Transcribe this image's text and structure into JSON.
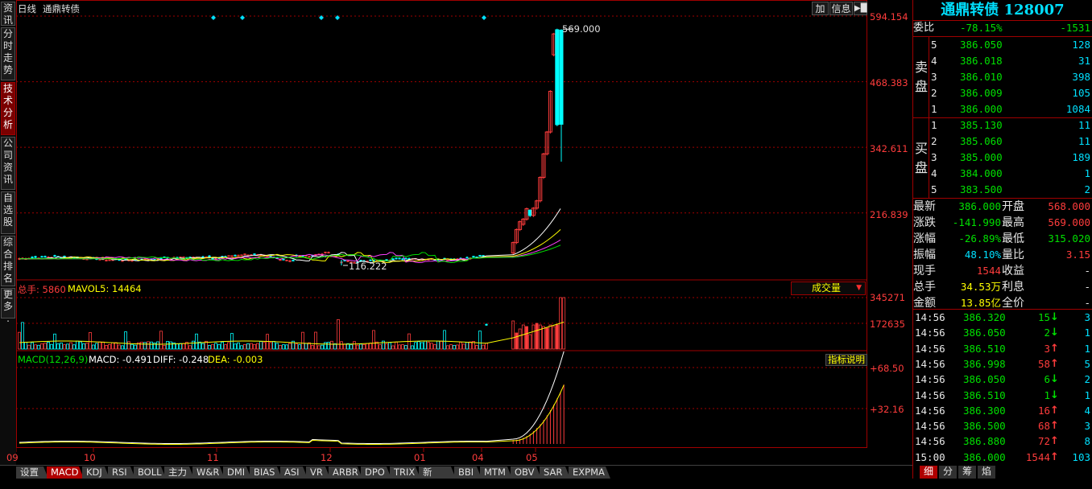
{
  "left_tabs": [
    {
      "label": "资讯",
      "active": false
    },
    {
      "label": "分时走势",
      "active": false
    },
    {
      "label": "技术分析",
      "active": true
    },
    {
      "label": "公司资讯",
      "active": false
    },
    {
      "label": "自选股",
      "active": false
    },
    {
      "label": "综合排名",
      "active": false
    },
    {
      "label": "更多.",
      "active": false
    }
  ],
  "chart_header": {
    "period": "日线",
    "name": "通鼎转债",
    "btn_add": "加",
    "btn_info": "信息"
  },
  "price_axis": [
    "594.154",
    "468.383",
    "342.611",
    "216.839"
  ],
  "price_annotations": {
    "high": "569.000",
    "low": "116.222"
  },
  "volume_pane": {
    "label_total": "总手:",
    "total_value": "5860",
    "label_mavol": "MAVOL5:",
    "mavol_value": "14464",
    "axis": [
      "345271",
      "172635"
    ],
    "selector": "成交量"
  },
  "macd_pane": {
    "label": "MACD(12,26,9)",
    "macd": "MACD: -0.491",
    "diff": "DIFF: -0.248",
    "dea": "DEA: -0.003",
    "axis": [
      "+68.50",
      "+32.16"
    ],
    "help": "指标说明"
  },
  "x_axis": [
    "09",
    "10",
    "11",
    "12",
    "01",
    "04",
    "05"
  ],
  "bottom_tabs": [
    "设置",
    "MACD",
    "KDJ",
    "RSI",
    "BOLL",
    "主力",
    "W&R",
    "DMI",
    "BIAS",
    "ASI",
    "VR",
    "ARBR",
    "DPO",
    "TRIX",
    "新DMA",
    "BBI",
    "MTM",
    "OBV",
    "SAR",
    "EXPMA"
  ],
  "bottom_active": "MACD",
  "quote": {
    "title": "通鼎转债 128007",
    "weibi": {
      "label": "委比",
      "pct": "-78.15%",
      "diff": "-1531"
    },
    "sell_label": "卖盘",
    "buy_label": "买盘",
    "asks": [
      {
        "lvl": "5",
        "price": "386.050",
        "vol": "128"
      },
      {
        "lvl": "4",
        "price": "386.018",
        "vol": "31"
      },
      {
        "lvl": "3",
        "price": "386.010",
        "vol": "398"
      },
      {
        "lvl": "2",
        "price": "386.009",
        "vol": "105"
      },
      {
        "lvl": "1",
        "price": "386.000",
        "vol": "1084"
      }
    ],
    "bids": [
      {
        "lvl": "1",
        "price": "385.130",
        "vol": "11"
      },
      {
        "lvl": "2",
        "price": "385.060",
        "vol": "11"
      },
      {
        "lvl": "3",
        "price": "385.000",
        "vol": "189"
      },
      {
        "lvl": "4",
        "price": "384.000",
        "vol": "1"
      },
      {
        "lvl": "5",
        "price": "383.500",
        "vol": "2"
      }
    ],
    "stats": [
      {
        "l1": "最新",
        "v1": "386.000",
        "c1": "green",
        "l2": "开盘",
        "v2": "568.000",
        "c2": "red"
      },
      {
        "l1": "涨跌",
        "v1": "-141.990",
        "c1": "green",
        "l2": "最高",
        "v2": "569.000",
        "c2": "red"
      },
      {
        "l1": "涨幅",
        "v1": "-26.89%",
        "c1": "green",
        "l2": "最低",
        "v2": "315.020",
        "c2": "green"
      },
      {
        "l1": "振幅",
        "v1": "48.10%",
        "c1": "cyan",
        "l2": "量比",
        "v2": "3.15",
        "c2": "red"
      },
      {
        "l1": "现手",
        "v1": "1544",
        "c1": "red",
        "l2": "收益",
        "v2": "-",
        "c2": "white"
      },
      {
        "l1": "总手",
        "v1": "34.53万",
        "c1": "yellow",
        "l2": "利息",
        "v2": "-",
        "c2": "white"
      },
      {
        "l1": "金额",
        "v1": "13.85亿",
        "c1": "yellow",
        "l2": "全价",
        "v2": "-",
        "c2": "white"
      }
    ],
    "ticks": [
      {
        "time": "14:56",
        "price": "386.320",
        "vol": "15",
        "dir": "down",
        "n": "3"
      },
      {
        "time": "14:56",
        "price": "386.050",
        "vol": "2",
        "dir": "down",
        "n": "1"
      },
      {
        "time": "14:56",
        "price": "386.510",
        "vol": "3",
        "dir": "up",
        "n": "1"
      },
      {
        "time": "14:56",
        "price": "386.998",
        "vol": "58",
        "dir": "up",
        "n": "5"
      },
      {
        "time": "14:56",
        "price": "386.050",
        "vol": "6",
        "dir": "down",
        "n": "2"
      },
      {
        "time": "14:56",
        "price": "386.510",
        "vol": "1",
        "dir": "down",
        "n": "1"
      },
      {
        "time": "14:56",
        "price": "386.300",
        "vol": "16",
        "dir": "up",
        "n": "4"
      },
      {
        "time": "14:56",
        "price": "386.500",
        "vol": "68",
        "dir": "up",
        "n": "3"
      },
      {
        "time": "14:56",
        "price": "386.880",
        "vol": "72",
        "dir": "up",
        "n": "8"
      },
      {
        "time": "15:00",
        "price": "386.000",
        "vol": "1544",
        "dir": "up",
        "n": "103"
      }
    ],
    "tabs": [
      "细",
      "分",
      "筹",
      "焰"
    ],
    "active_tab": "细"
  },
  "chart_data": {
    "type": "candlestick",
    "y_ticks": [
      594.154,
      468.383,
      342.611,
      216.839
    ],
    "ylim": [
      116.222,
      594.154
    ],
    "volume_ticks": [
      345271,
      172635
    ],
    "macd_ticks": [
      68.5,
      32.16
    ],
    "last_candle": {
      "open": 568.0,
      "high": 569.0,
      "low": 315.02,
      "close": 386.0
    }
  }
}
